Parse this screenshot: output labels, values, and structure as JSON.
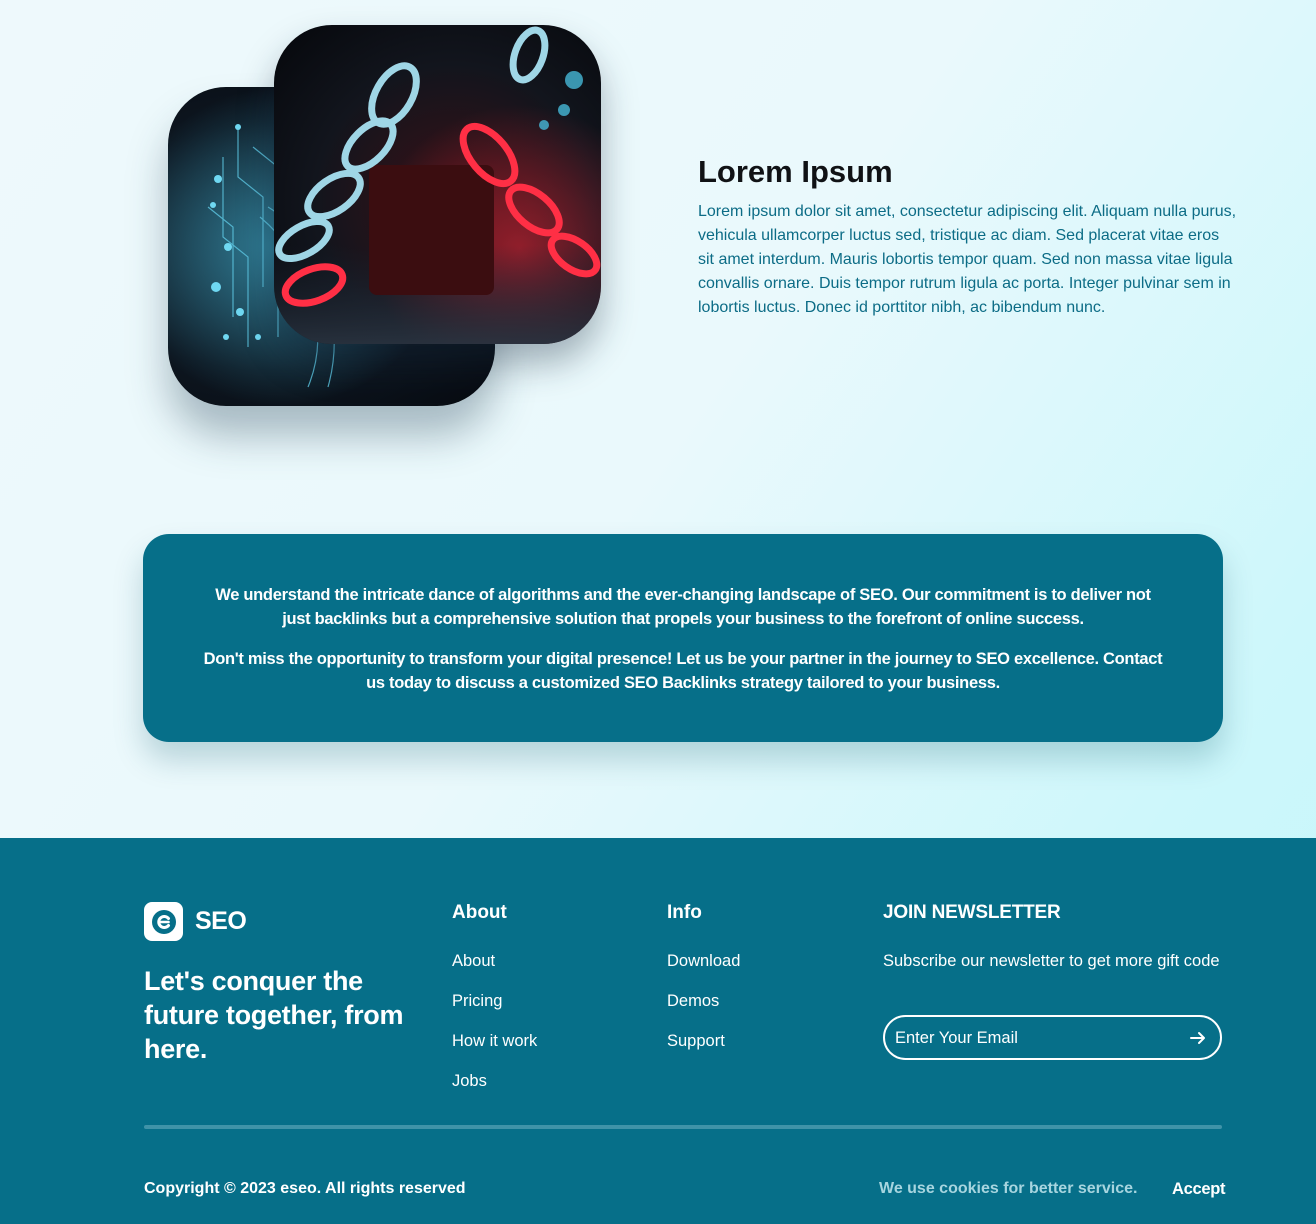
{
  "intro": {
    "title": "Lorem Ipsum",
    "body": "Lorem ipsum dolor sit amet, consectetur adipiscing elit. Aliquam nulla purus, vehicula ullamcorper luctus sed, tristique ac diam. Sed placerat vitae eros sit amet interdum. Mauris lobortis tempor quam. Sed non massa vitae ligula convallis ornare. Duis tempor rutrum ligula ac porta. Integer pulvinar sem in lobortis luctus. Donec id porttitor nibh, ac bibendum nunc."
  },
  "cta": {
    "paragraph_1": "We understand the intricate dance of algorithms and the ever-changing landscape of SEO. Our commitment is to deliver not just backlinks but a comprehensive solution that propels your business to the forefront of online success.",
    "paragraph_2": "Don't miss the opportunity to transform your digital presence! Let us be your partner in the journey to SEO excellence. Contact us today to discuss a customized SEO Backlinks strategy tailored to your business."
  },
  "footer": {
    "brand": "SEO",
    "tagline": "Let's conquer the future together, from here.",
    "about": {
      "heading": "About",
      "links": [
        "About",
        "Pricing",
        "How it work",
        "Jobs"
      ]
    },
    "info": {
      "heading": "Info",
      "links": [
        "Download",
        "Demos",
        "Support"
      ]
    },
    "newsletter": {
      "heading": "JOIN NEWSLETTER",
      "text": "Subscribe our newsletter to get more gift code",
      "placeholder": "Enter Your Email"
    },
    "copyright": "Copyright © 2023 eseo. All rights reserved",
    "cookie_text": "We use cookies for better service.",
    "accept_label": "Accept"
  },
  "colors": {
    "primary": "#066f89",
    "accent_text": "#0c6c86",
    "background": "#eaf9fc"
  }
}
